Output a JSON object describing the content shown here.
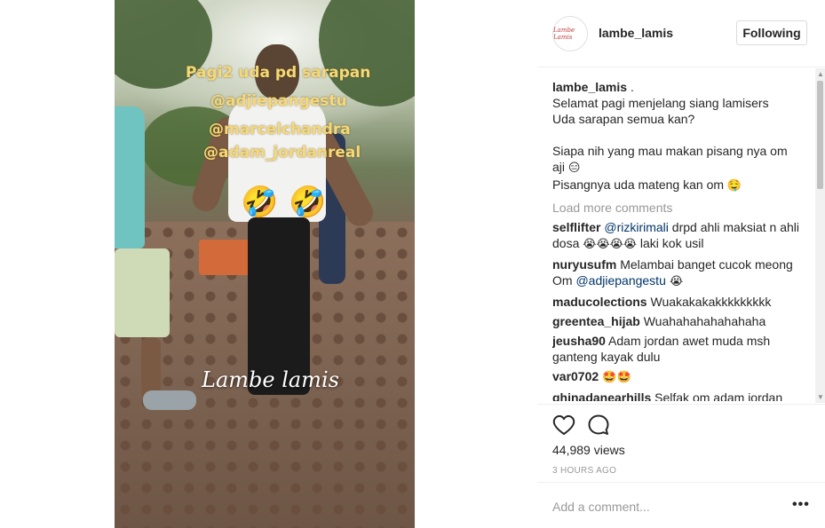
{
  "post": {
    "video_overlay": {
      "line1": "Pagi2 uda pd sarapan",
      "line2": "@adjiepangestu",
      "line3": "@marcelchandra",
      "line4": "@adam_jordanreal",
      "emoji": "🤣",
      "watermark": "Lambe lamis"
    }
  },
  "header": {
    "avatar_text": "Lambe Lamis",
    "username": "lambe_lamis",
    "follow_label": "Following"
  },
  "caption": {
    "username": "lambe_lamis",
    "username_suffix": " .",
    "line1": "Selamat pagi menjelang siang lamisers",
    "line2": "Uda sarapan semua kan?",
    "line3": "Siapa nih yang mau makan pisang nya om",
    "line4a": "aji ",
    "line4_emoji": "😑",
    "line5a": "Pisangnya uda mateng kan om ",
    "line5_emoji": "🤤"
  },
  "load_more_label": "Load more comments",
  "comments": [
    {
      "user": "selflifter",
      "mention": "@rizkirimali",
      "text": " drpd ahli maksiat n ahli dosa ",
      "emojis": "😭😭😭😭",
      "tail": " laki kok usil"
    },
    {
      "user": "nuryusufm",
      "text": " Melambai banget cucok meong Om ",
      "mention": "@adjiepangestu",
      "emojis": " 😭"
    },
    {
      "user": "maducolections",
      "text": " Wuakakakakkkkkkkkk"
    },
    {
      "user": "greentea_hijab",
      "text": " Wuahahahahahahaha"
    },
    {
      "user": "jeusha90",
      "text": " Adam jordan awet muda msh ganteng kayak dulu"
    },
    {
      "user": "var0702",
      "emojis": " 🤩🤩"
    },
    {
      "user": "ghinadanearhills",
      "text": " Selfak om adam jordan"
    }
  ],
  "actions": {
    "like_icon": "heart-icon",
    "comment_icon": "comment-bubble-icon",
    "views": "44,989 views",
    "time": "3 HOURS AGO"
  },
  "add_comment": {
    "placeholder": "Add a comment...",
    "more_label": "•••"
  }
}
